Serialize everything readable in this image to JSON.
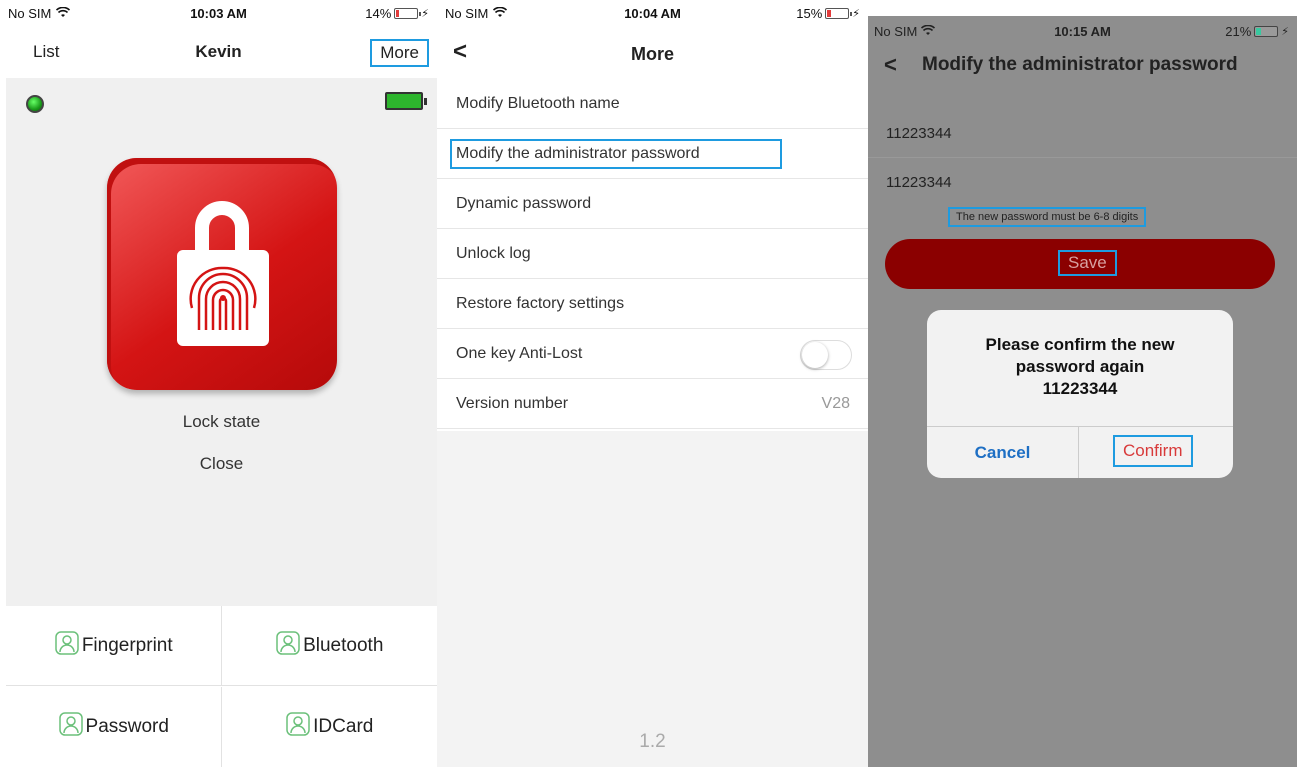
{
  "panel1": {
    "status": {
      "carrier": "No SIM",
      "time": "10:03 AM",
      "battery": "14%"
    },
    "nav": {
      "left": "List",
      "title": "Kevin",
      "right": "More"
    },
    "lock_state_label": "Lock state",
    "lock_state_value": "Close",
    "methods": [
      {
        "label": "Fingerprint",
        "icon": "user-frame-icon"
      },
      {
        "label": "Bluetooth",
        "icon": "user-frame-icon"
      },
      {
        "label": "Password",
        "icon": "user-frame-icon"
      },
      {
        "label": "IDCard",
        "icon": "user-frame-icon"
      }
    ],
    "colors": {
      "lock_red": "#d41414",
      "status_green": "#2db52d",
      "highlight": "#1e9be0"
    }
  },
  "panel2": {
    "status": {
      "carrier": "No SIM",
      "time": "10:04 AM",
      "battery": "15%"
    },
    "nav": {
      "back": "<",
      "title": "More"
    },
    "menu": [
      {
        "label": "Modify Bluetooth name"
      },
      {
        "label": "Modify the administrator password"
      },
      {
        "label": "Dynamic password"
      },
      {
        "label": "Unlock log"
      },
      {
        "label": "Restore factory settings"
      },
      {
        "label": "One key Anti-Lost"
      },
      {
        "label": "Version number",
        "value": "V28"
      }
    ],
    "app_version": "1.2"
  },
  "panel3": {
    "status": {
      "carrier": "No SIM",
      "time": "10:15 AM",
      "battery": "21%"
    },
    "nav": {
      "back": "<",
      "title": "Modify the administrator password"
    },
    "new_password": "11223344",
    "confirm_password": "11223344",
    "hint": "The new password must be 6-8 digits",
    "save_label": "Save",
    "dialog": {
      "line1": "Please confirm the new",
      "line2": "password again",
      "line3": "11223344",
      "cancel": "Cancel",
      "confirm": "Confirm"
    },
    "colors": {
      "save_bg": "#8b0000",
      "overlay": "#8e8e8e",
      "cancel_text": "#1e6fc4",
      "confirm_text": "#d83a3a"
    }
  }
}
